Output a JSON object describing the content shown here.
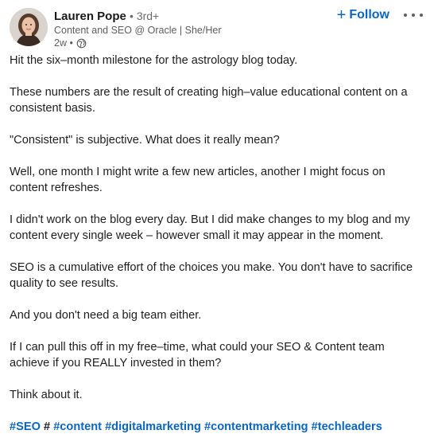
{
  "post": {
    "author": {
      "name": "Lauren Pope",
      "degree": "• 3rd+",
      "headline": "Content and SEO @ Oracle | She/Her",
      "time": "2w •",
      "visibility_icon": "globe-icon"
    },
    "follow_label": "Follow",
    "follow_icon": "plus-icon",
    "more_icon": "more-options-icon",
    "paragraphs": [
      "Hit the six–month milestone for the astrology blog today.",
      "These numbers are the result of creating high–value educational content on a consistent basis.",
      "\"Consistent\" is subjective. What does it really mean?",
      "Well, one month I might write a few new articles, another I might focus on content refreshes.",
      "I didn't work on the blog every day. But I did make changes to my blog and my content every single week – however small it may appear in the moment.",
      "SEO is a cumulative effort of the choices you make. You don't have to sacrifice quality to see results.",
      "And you don't need a big team either.",
      "If I can pull this off in my free–time, what could your SEO & Content team achieve if you REALLY invested in them?",
      "Think about it."
    ],
    "hashtags": {
      "seo": "#SEO",
      "plain": "#",
      "content": "#content",
      "digitalmarketing": "#digitalmarketing",
      "contentmarketing": "#contentmarketing",
      "techleaders": "#techleaders"
    },
    "colors": {
      "link": "#0a66c2",
      "text": "#1e1e1e",
      "muted": "#5e5e5e"
    }
  }
}
